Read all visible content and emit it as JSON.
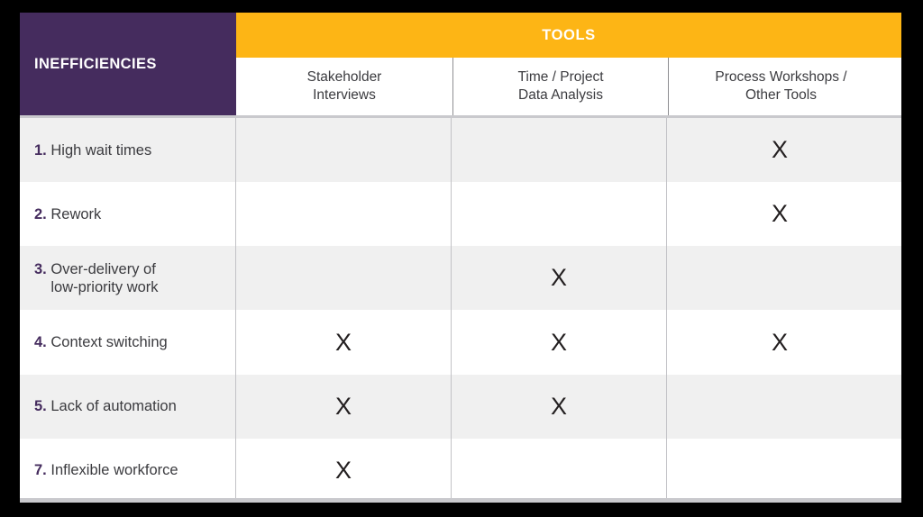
{
  "colors": {
    "purple": "#452C5E",
    "orange": "#FDB515",
    "row_shade": "#f0f0f0",
    "row_plain": "#ffffff",
    "text_dark": "#3b3b3f",
    "mark": "#231F20",
    "frame": "#000000"
  },
  "matrix": {
    "corner_header": "INEFFICIENCIES",
    "group_header": "TOOLS",
    "columns": [
      {
        "line1": "Stakeholder",
        "line2": "Interviews"
      },
      {
        "line1": "Time / Project",
        "line2": "Data Analysis"
      },
      {
        "line1": "Process Workshops /",
        "line2": "Other Tools"
      }
    ],
    "mark_glyph": "X",
    "rows": [
      {
        "num": "1.",
        "line1": "High wait times",
        "line2": "",
        "shaded": true,
        "marks": [
          "",
          "",
          "X"
        ]
      },
      {
        "num": "2.",
        "line1": "Rework",
        "line2": "",
        "shaded": false,
        "marks": [
          "",
          "",
          "X"
        ]
      },
      {
        "num": "3.",
        "line1": "Over-delivery of",
        "line2": "low-priority work",
        "shaded": true,
        "marks": [
          "",
          "X",
          ""
        ]
      },
      {
        "num": "4.",
        "line1": "Context switching",
        "line2": "",
        "shaded": false,
        "marks": [
          "X",
          "X",
          "X"
        ]
      },
      {
        "num": "5.",
        "line1": "Lack of automation",
        "line2": "",
        "shaded": true,
        "marks": [
          "X",
          "X",
          ""
        ]
      },
      {
        "num": "7.",
        "line1": "Inflexible workforce",
        "line2": "",
        "shaded": false,
        "marks": [
          "X",
          "",
          ""
        ]
      }
    ]
  }
}
